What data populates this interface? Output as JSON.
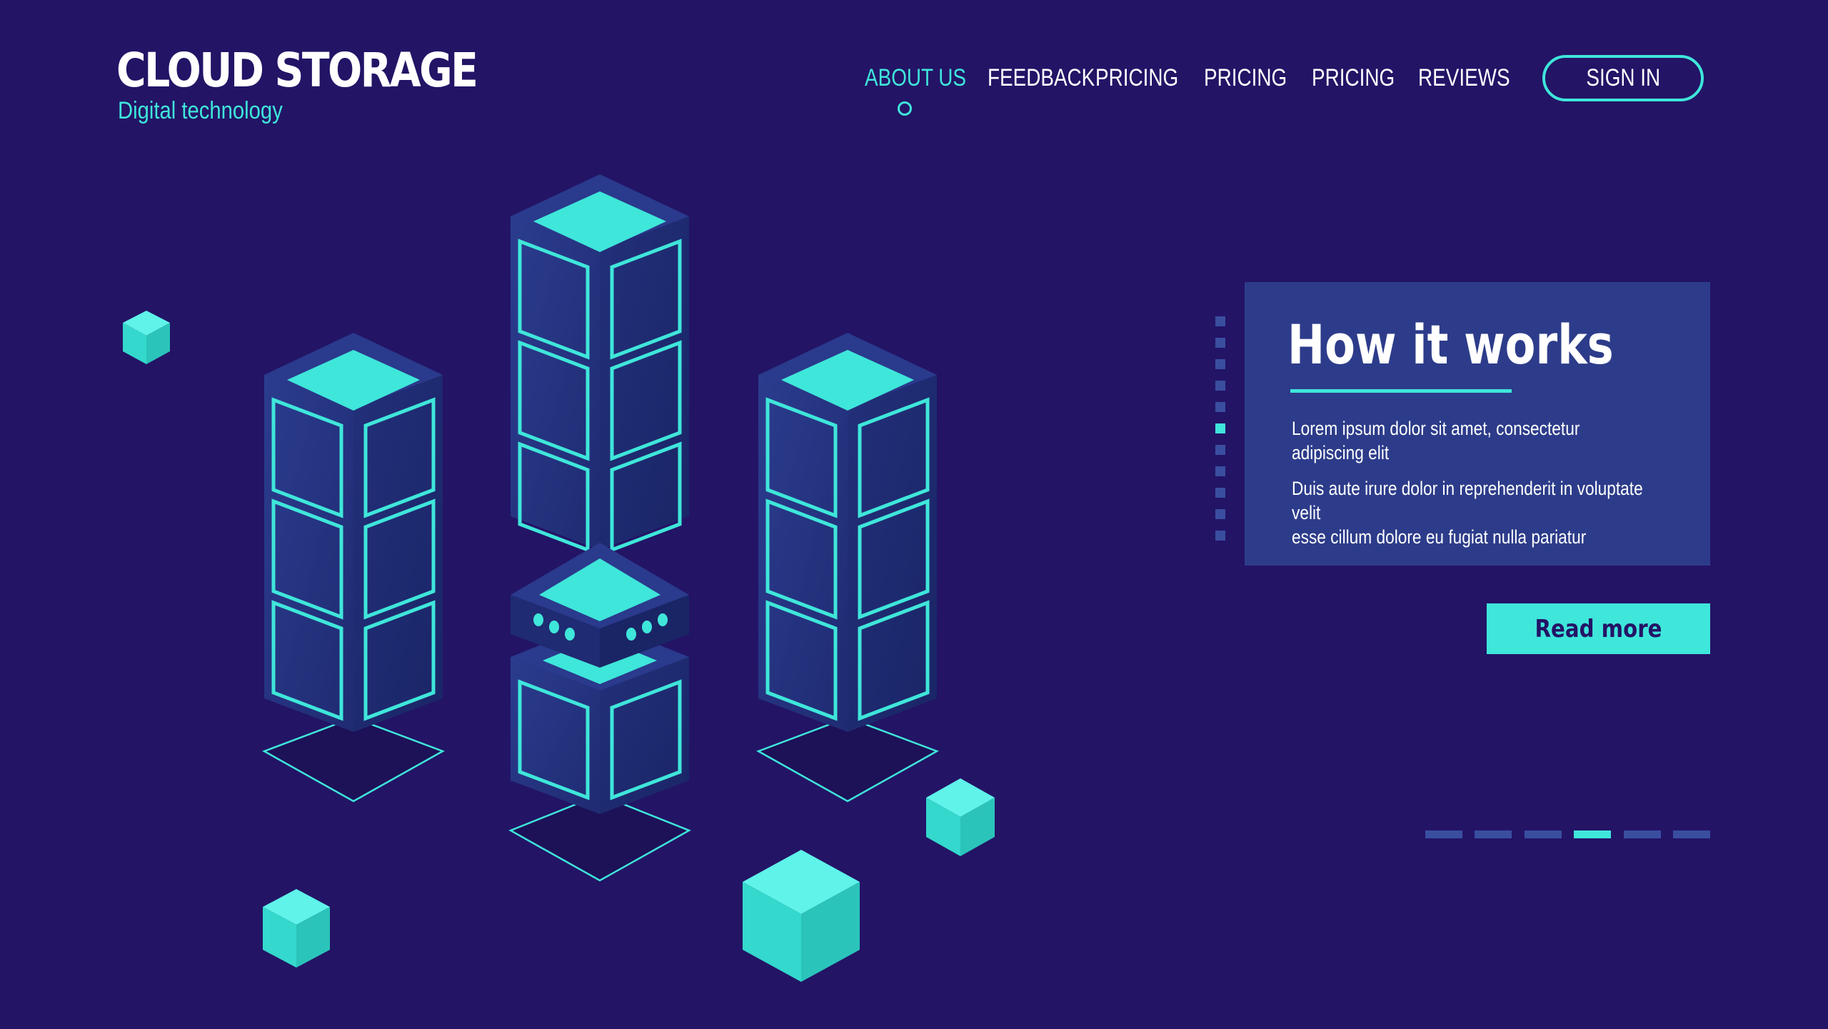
{
  "brand": {
    "title": "CLOUD STORAGE",
    "subtitle": "Digital technology"
  },
  "nav": {
    "items": [
      {
        "label": "ABOUT US",
        "active": true
      },
      {
        "label": "FEEDBACK",
        "active": false
      },
      {
        "label": "PRICING",
        "active": false
      },
      {
        "label": "PRICING",
        "active": false
      },
      {
        "label": "PRICING",
        "active": false
      },
      {
        "label": "REVIEWS",
        "active": false
      }
    ],
    "signin_label": "SIGN IN"
  },
  "card": {
    "title": "How it works",
    "paragraph1": "Lorem ipsum dolor sit amet, consectetur\nadipiscing elit",
    "paragraph2": "Duis aute irure dolor in reprehenderit in voluptate velit\nesse cillum dolore eu fugiat nulla pariatur",
    "read_more_label": "Read more",
    "steps_total": 11,
    "steps_active_index": 5
  },
  "slider": {
    "total": 6,
    "active_index": 3
  },
  "colors": {
    "background": "#231466",
    "accent": "#3fe6da",
    "card": "#2d3c8a",
    "inactive": "#3a4ea0"
  }
}
